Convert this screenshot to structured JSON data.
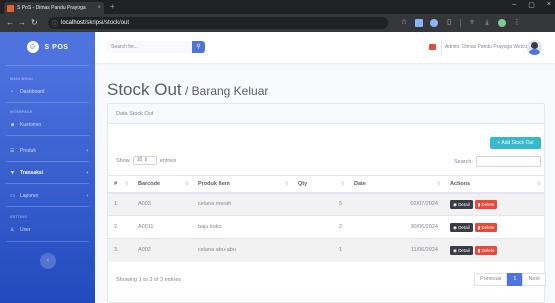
{
  "browser": {
    "tab_title": "S PoS - Dimas Pandu Prayoga",
    "tab_close": "×",
    "new_tab": "+",
    "url_host": "localhost",
    "url_path": "/skripsi/stock/out",
    "window_controls": [
      "–",
      "▢",
      "×"
    ]
  },
  "sidebar": {
    "brand": "S POS",
    "heading_main": "MAIN MENU",
    "dashboard": "Dashboard",
    "heading_interface": "INTERFACE",
    "kustomer": "Kustomer",
    "produk": "Produk",
    "transaksi": "Transaksi",
    "laporan": "Laporan",
    "heading_setting": "SETTING",
    "user": "User"
  },
  "topbar": {
    "search_placeholder": "Search for...",
    "username": "Admin: Dimas Pandu Prayoga Welco"
  },
  "page": {
    "title": "Stock Out",
    "subtitle": " / Barang Keluar"
  },
  "card": {
    "header": "Data Stock Out",
    "add_button": "+ Add Stock Out",
    "show_label": "Show",
    "entries_value": "10",
    "entries_label": "entries",
    "search_label": "Search:",
    "columns": [
      "#",
      "Barcode",
      "Produk Item",
      "Qty",
      "Date",
      "Actions"
    ],
    "rows": [
      {
        "no": "1.",
        "barcode": "A003",
        "item": "celana merah",
        "qty": "5",
        "date": "02/07/2024"
      },
      {
        "no": "2.",
        "barcode": "A0011",
        "item": "baju koko",
        "qty": "2",
        "date": "30/06/2024"
      },
      {
        "no": "3.",
        "barcode": "A002",
        "item": "celana abu-abu",
        "qty": "1",
        "date": "11/06/2024"
      }
    ],
    "detail_label": "Detail",
    "delete_label": "Delete",
    "showing": "Showing 1 to 3 of 3 entries",
    "pager": {
      "previous": "Previous",
      "current": "1",
      "next": "Next"
    }
  },
  "colors": {
    "primary": "#4e73df",
    "info": "#36b9cc",
    "danger": "#e74a3b",
    "dark": "#3a3b45"
  }
}
